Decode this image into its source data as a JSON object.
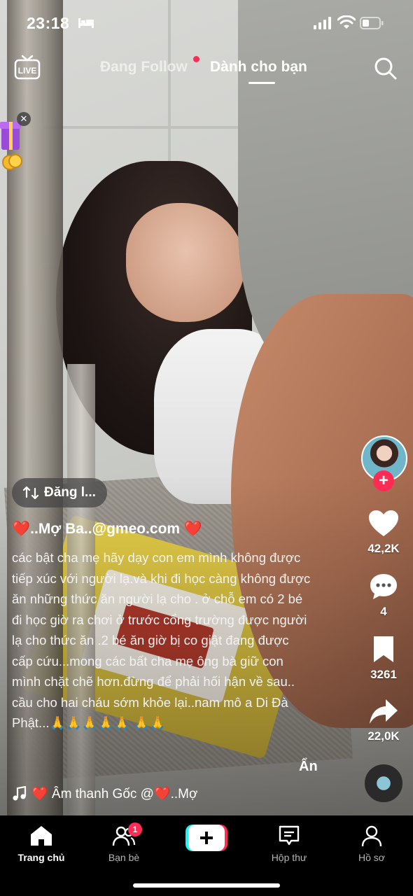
{
  "status_bar": {
    "time": "23:18"
  },
  "top_nav": {
    "live_label": "LIVE",
    "tab_following": "Đang Follow",
    "tab_for_you": "Dành cho bạn"
  },
  "video": {
    "repost_label": "Đăng l...",
    "username": "❤️..Mợ Ba..@gmeo.com ❤️",
    "caption": "các bật cha mẹ hãy dạy con em mình không được tiếp xúc với người lạ.và khi đi học càng không được ăn những thức ăn người lạ cho . ở chỗ em có 2 bé đi học giờ ra chơi ở trước cổng trường được người lạ cho thức ăn .2 bé ăn giờ bị co giật đang được cấp cứu...mong các bất cha mẹ ông bà giữ con mình chặt chẽ hơn.đừng để phải hối hận về sau.. cầu cho hai cháu sớm khỏe lại..nam mô a Di Đà Phật...🙏🙏🙏🙏🙏 🙏🙏",
    "hide_label": "Ẩn",
    "music": "❤️ Âm thanh Gốc  @❤️..Mợ"
  },
  "actions": {
    "likes": "42,2K",
    "comments": "4",
    "saves": "3261",
    "shares": "22,0K"
  },
  "bottom_nav": {
    "home": "Trang chủ",
    "friends": "Bạn bè",
    "friends_badge": "1",
    "inbox": "Hộp thư",
    "profile": "Hồ sơ"
  },
  "colors": {
    "accent": "#fe2c55",
    "cyan": "#25f4ee"
  }
}
